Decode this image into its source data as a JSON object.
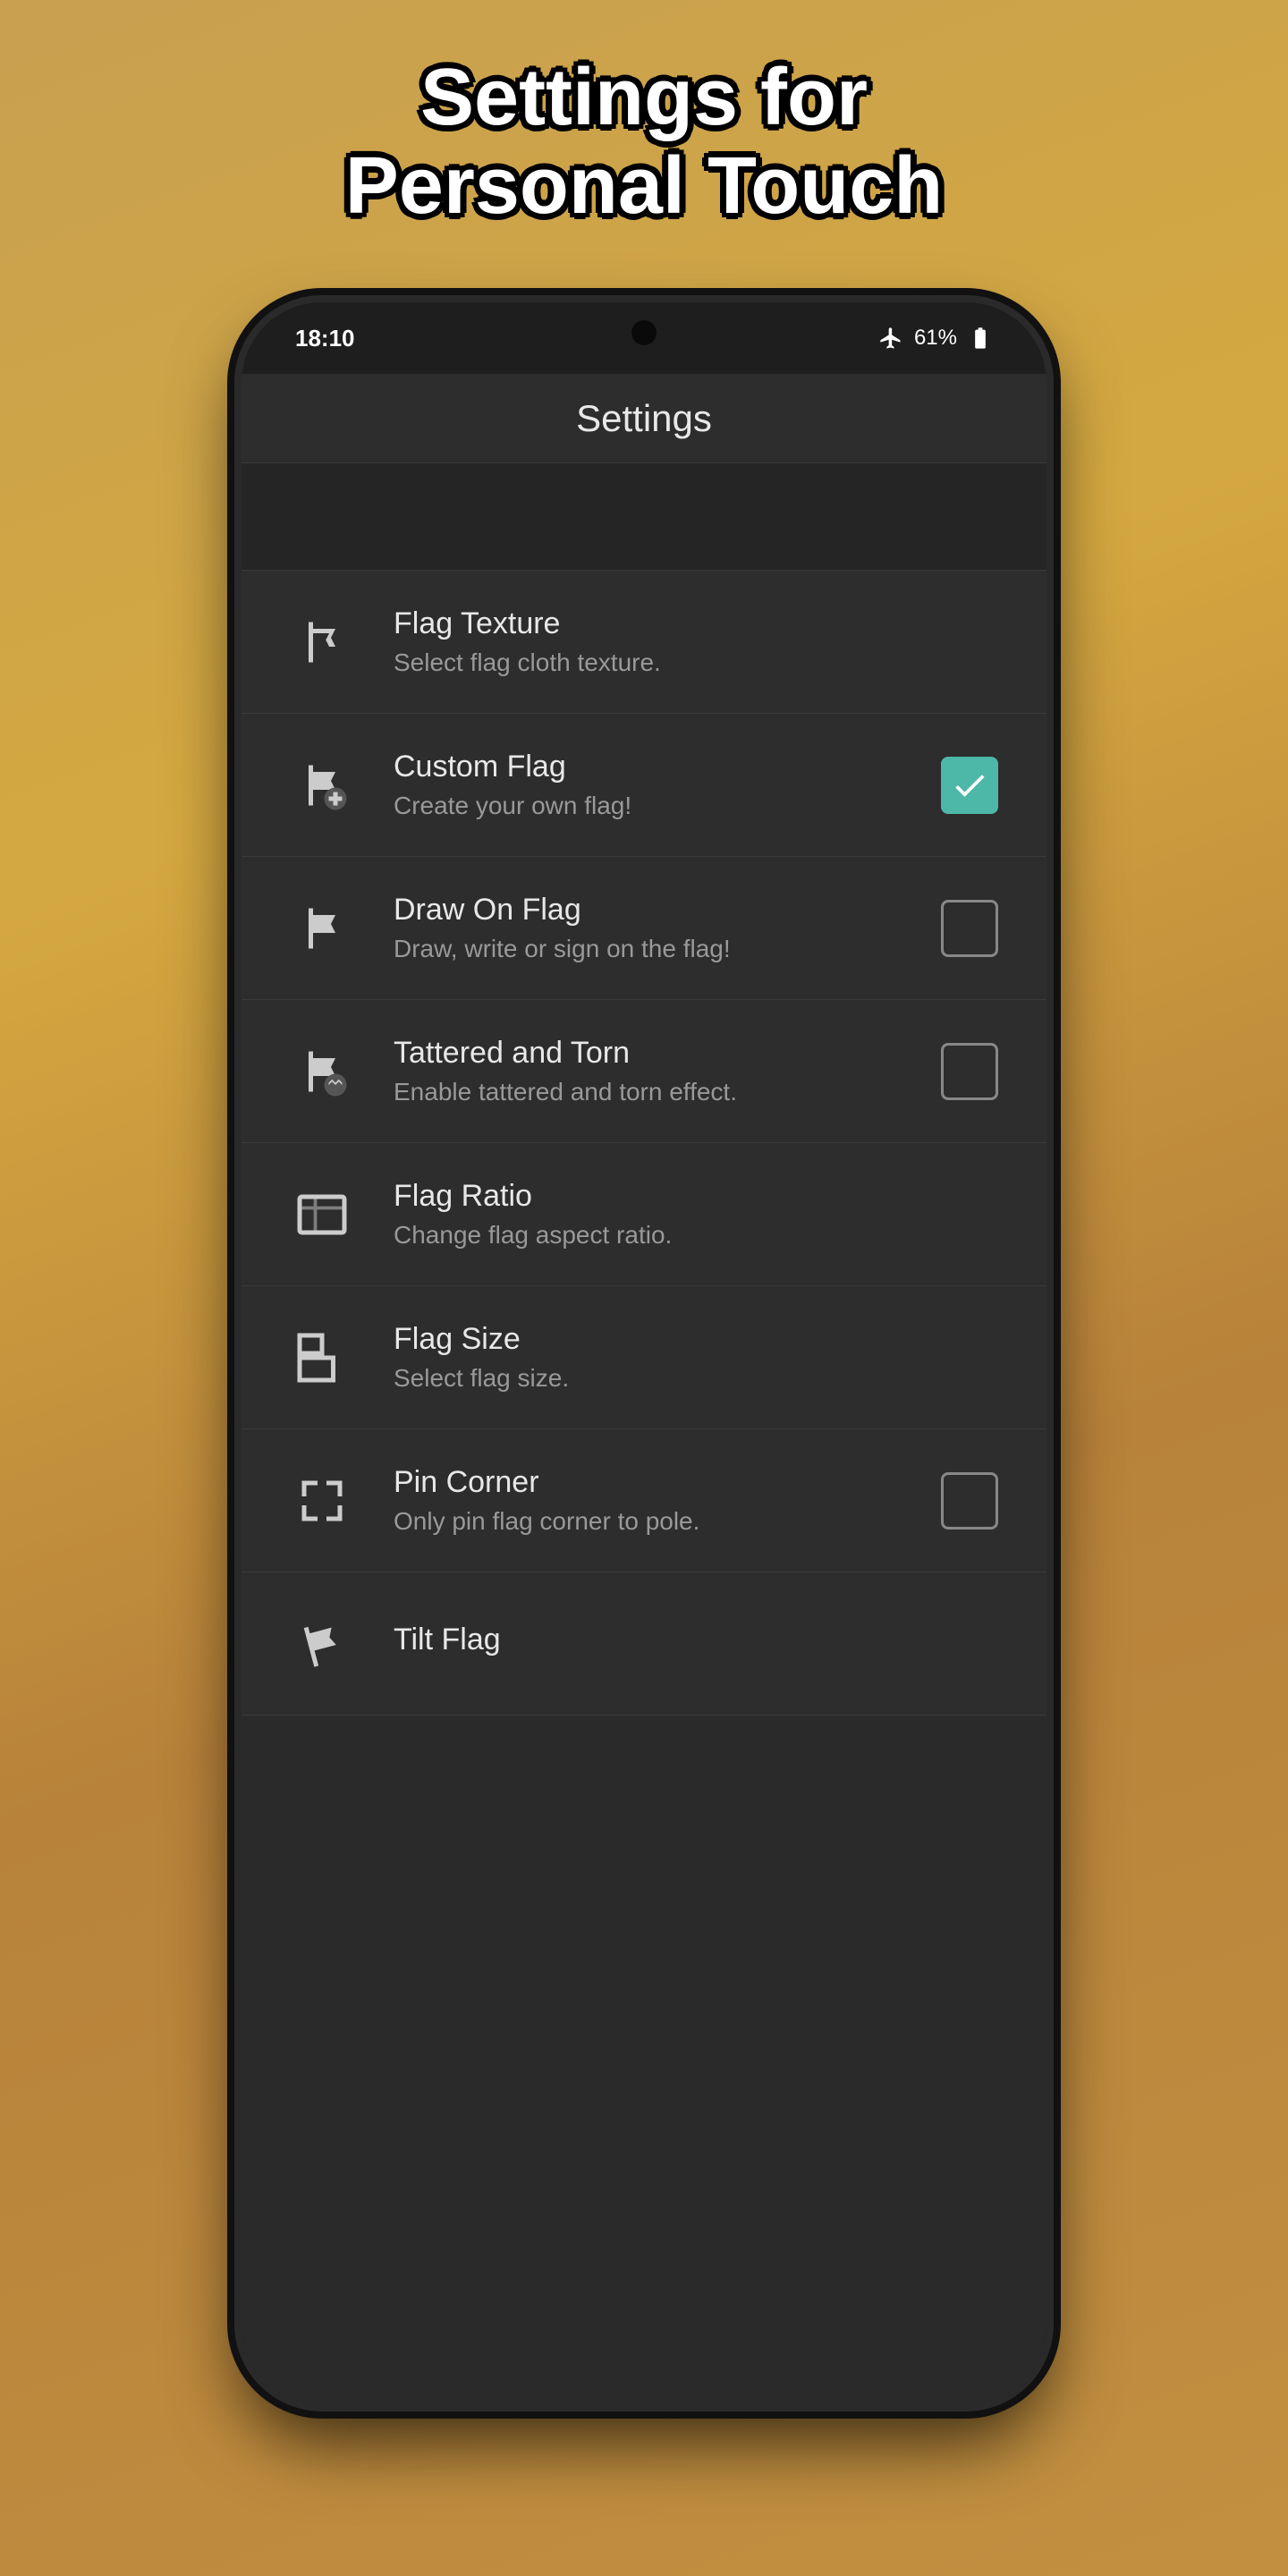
{
  "page": {
    "title_line1": "Settings for",
    "title_line2": "Personal Touch"
  },
  "status_bar": {
    "time": "18:10",
    "battery": "61%"
  },
  "app_bar": {
    "title": "Settings"
  },
  "settings_items": [
    {
      "id": "flag-texture",
      "title": "Flag Texture",
      "subtitle": "Select flag cloth texture.",
      "icon": "flag-texture-icon",
      "control": "none"
    },
    {
      "id": "custom-flag",
      "title": "Custom Flag",
      "subtitle": "Create your own flag!",
      "icon": "custom-flag-icon",
      "control": "checked"
    },
    {
      "id": "draw-on-flag",
      "title": "Draw On Flag",
      "subtitle": "Draw, write or sign on the flag!",
      "icon": "draw-flag-icon",
      "control": "unchecked"
    },
    {
      "id": "tattered-torn",
      "title": "Tattered and Torn",
      "subtitle": "Enable tattered and torn effect.",
      "icon": "tattered-icon",
      "control": "unchecked"
    },
    {
      "id": "flag-ratio",
      "title": "Flag Ratio",
      "subtitle": "Change flag aspect ratio.",
      "icon": "flag-ratio-icon",
      "control": "none"
    },
    {
      "id": "flag-size",
      "title": "Flag Size",
      "subtitle": "Select flag size.",
      "icon": "flag-size-icon",
      "control": "none"
    },
    {
      "id": "pin-corner",
      "title": "Pin Corner",
      "subtitle": "Only pin flag corner to pole.",
      "icon": "pin-corner-icon",
      "control": "unchecked"
    },
    {
      "id": "tilt-flag",
      "title": "Tilt Flag",
      "subtitle": "",
      "icon": "tilt-flag-icon",
      "control": "none"
    }
  ]
}
